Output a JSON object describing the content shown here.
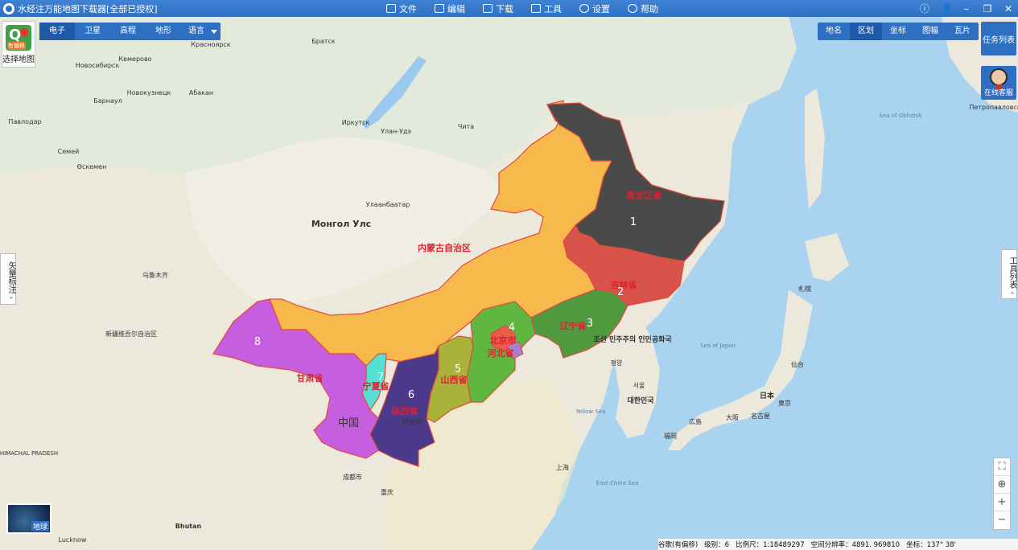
{
  "window": {
    "title": "水经注万能地图下载器[全部已授权]",
    "menu": [
      {
        "label": "文件",
        "icon": "folder-icon"
      },
      {
        "label": "编辑",
        "icon": "edit-icon"
      },
      {
        "label": "下载",
        "icon": "download-icon"
      },
      {
        "label": "工具",
        "icon": "toolbox-icon"
      },
      {
        "label": "设置",
        "icon": "gear-icon"
      },
      {
        "label": "帮助",
        "icon": "help-icon"
      }
    ],
    "controls": [
      "ⓘ",
      "👤",
      "–",
      "❐",
      "✕"
    ]
  },
  "map_select": {
    "label": "选择地图",
    "badge": "有偏移"
  },
  "map_types": [
    "电子",
    "卫星",
    "高程",
    "地形"
  ],
  "map_types_active": "电子",
  "language": "语言",
  "layer_tabs": [
    "地名",
    "区划",
    "坐标",
    "图幅",
    "瓦片"
  ],
  "layer_tabs_active": "区划",
  "task_list": "任务列表",
  "online_service": "在线客服",
  "vector_label": "矢量标注",
  "tool_list": "工具列表",
  "globe_label": "地球",
  "zoom_icons": [
    "fullscreen-icon",
    "locate-icon",
    "zoom-in-icon",
    "zoom-out-icon"
  ],
  "status_bar": {
    "source": "谷歌(有偏移)",
    "level": "级别：6",
    "scale": "比例尺：1:18489297",
    "resolution": "空间分辨率：4891. 969810",
    "coord": "坐标：137° 38'"
  },
  "regions": [
    {
      "name": "黑龙江省",
      "number": "1",
      "color": "#4a4a4a"
    },
    {
      "name": "吉林省",
      "number": "2",
      "color": "#d9534a"
    },
    {
      "name": "辽宁省",
      "number": "3",
      "color": "#4f9a3e"
    },
    {
      "name": "北京市",
      "number": "4",
      "color": "#e85c4a"
    },
    {
      "name": "河北省",
      "number": "4",
      "color": "#5fb742"
    },
    {
      "name": "山西省",
      "number": "5",
      "color": "#a9b239"
    },
    {
      "name": "陕西省",
      "number": "6",
      "color": "#4b3a8c"
    },
    {
      "name": "宁夏省",
      "number": "7",
      "color": "#55e0d6"
    },
    {
      "name": "甘肃省",
      "number": "8",
      "color": "#c65ee0"
    },
    {
      "name": "内蒙古自治区",
      "number": "",
      "color": "#f7b94c"
    }
  ],
  "map_labels": {
    "mongolia": "Монгол Улс",
    "ulaanbaatar": "Улаанбаатар",
    "china": "中国",
    "korea_n": "조선 민주주의 인민공화국",
    "korea_s": "대한민국",
    "japan": "日本",
    "sea_japan": "Sea of Japan",
    "sea_okhotsk": "Sea of Okhotsk",
    "yellow_sea": "Yellow Sea",
    "east_china_sea": "East China Sea",
    "xian": "西安市",
    "chengdu": "成都市",
    "chongqing": "重庆",
    "shanghai": "上海",
    "tokyo": "東京",
    "osaka": "大阪",
    "nagoya": "名古屋",
    "hiroshima": "広島",
    "fukuoka": "福岡",
    "sendai": "仙台",
    "sapporo": "札幌",
    "seoul": "서울",
    "pyongyang": "평양",
    "irkutsk": "Иркутск",
    "krasnoyarsk": "Красноярск",
    "novosibirsk": "Новосибирск",
    "kemerovo": "Кемерово",
    "novokuznetsk": "Новокузнецк",
    "barnaul": "Барнаул",
    "pavlodar": "Павлодар",
    "semey": "Семей",
    "oskemen": "Өскемен",
    "abakan": "Абакан",
    "bratsk": "Братск",
    "ulan_ude": "Улан-Удэ",
    "chita": "Чита",
    "urumqi": "乌鲁木齐",
    "xinjiang": "新疆维吾尔自治区",
    "lucknow": "Lucknow",
    "bhutan": "Bhutan",
    "himachal": "HIMACHAL PRADESH",
    "petropavlovsk": "Петропавловск-"
  }
}
